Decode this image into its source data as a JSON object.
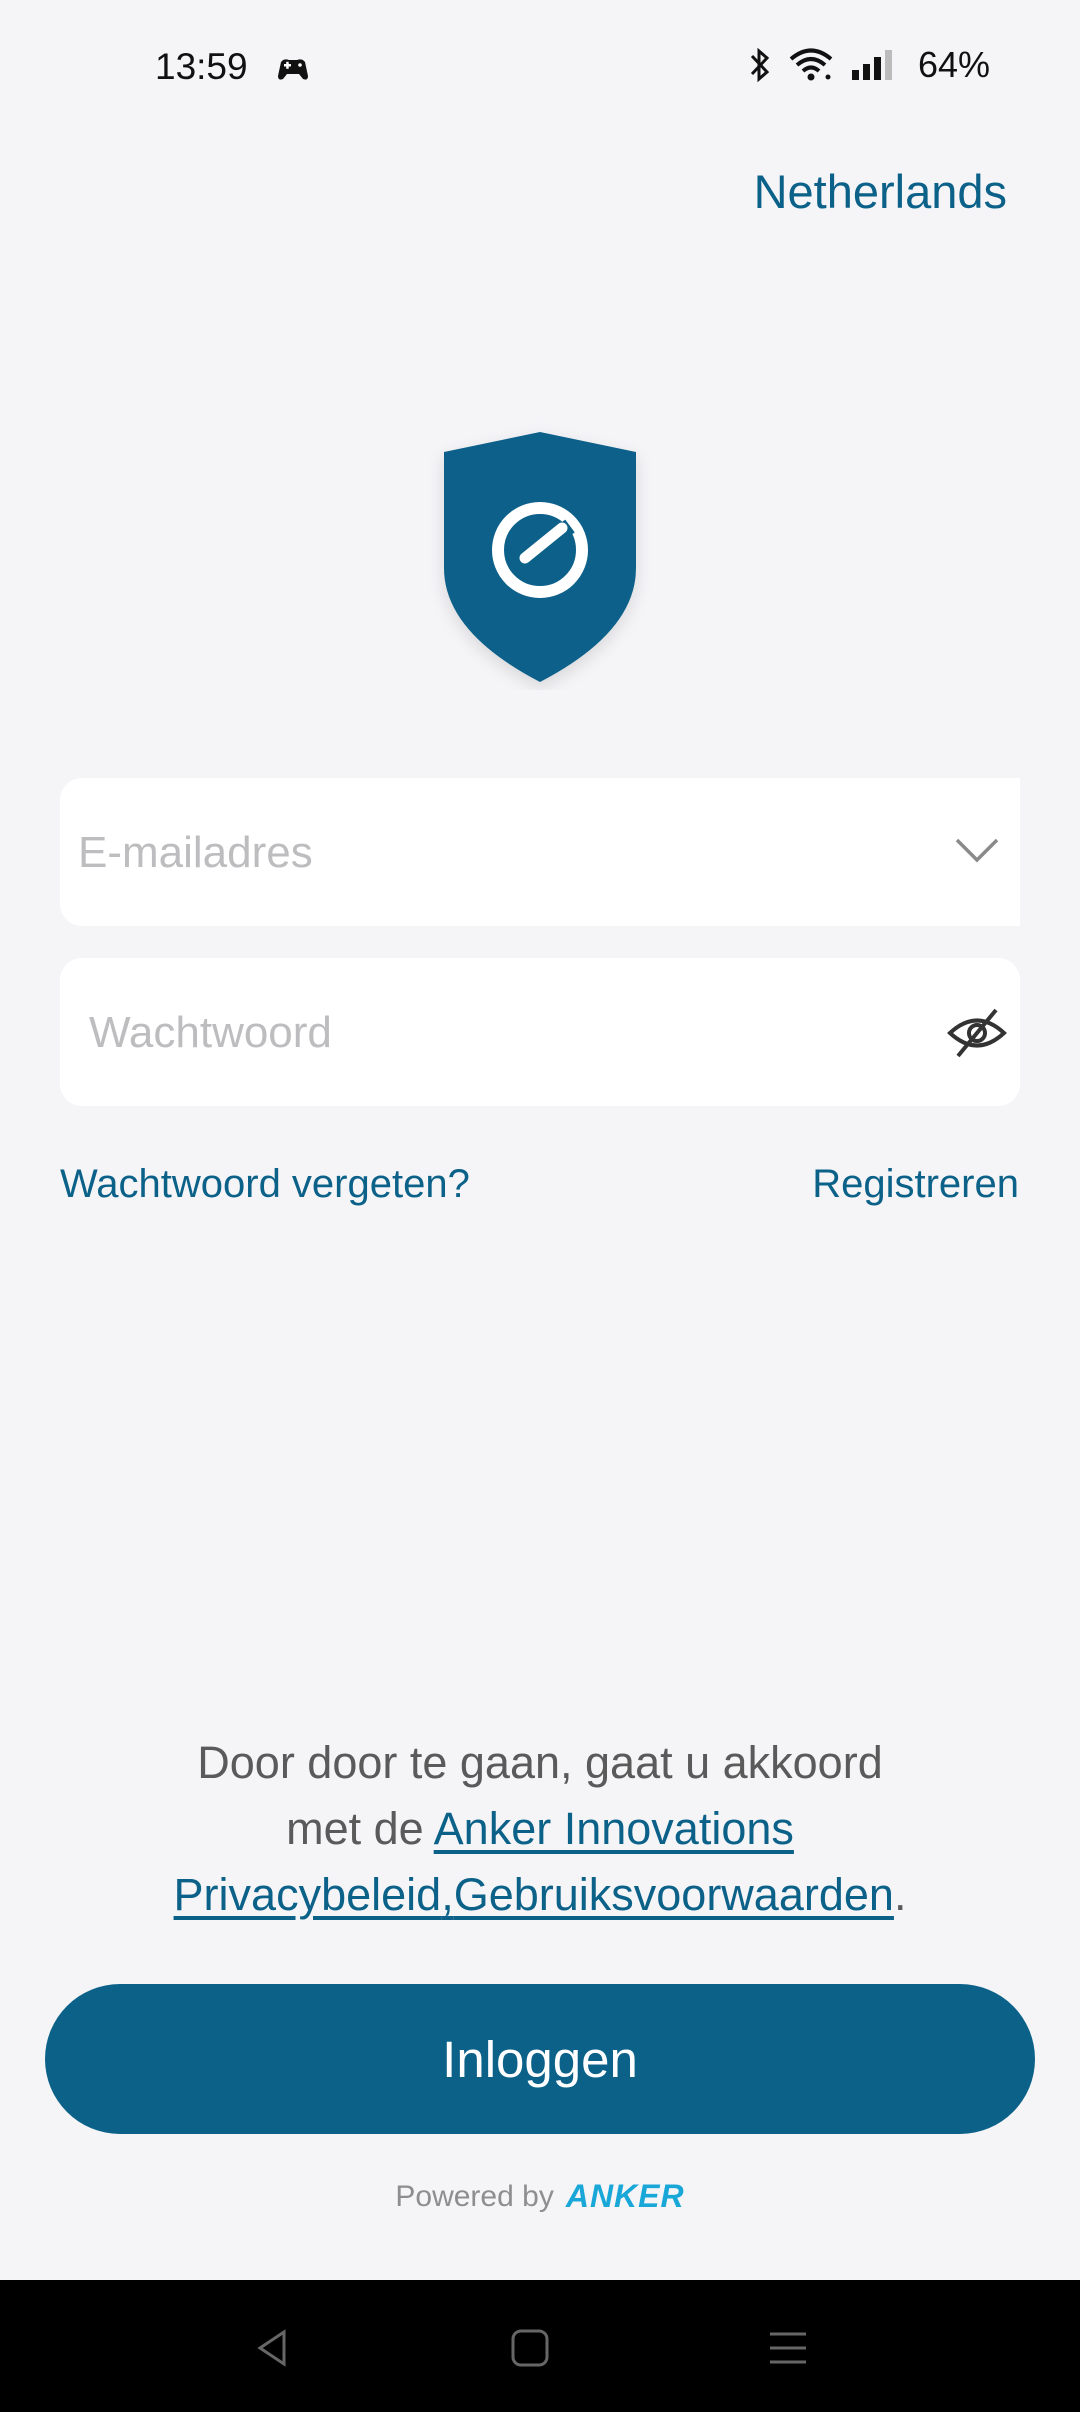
{
  "status_bar": {
    "time": "13:59",
    "battery": "64%",
    "icons": [
      "game-controller-icon",
      "bluetooth-icon",
      "wifi-icon",
      "cellular-signal-icon"
    ]
  },
  "header": {
    "region": "Netherlands"
  },
  "logo": {
    "icon": "eufy-shield-logo",
    "color": "#0c6189"
  },
  "form": {
    "email_placeholder": "E-mailadres",
    "email_value": "",
    "password_placeholder": "Wachtwoord",
    "password_value": "",
    "forgot_password": "Wachtwoord vergeten?",
    "register": "Registreren"
  },
  "terms": {
    "text_1": "Door door te gaan, gaat u akkoord",
    "text_2": "met de ",
    "link_1": "Anker Innovations",
    "link_2": "Privacybeleid",
    "separator": ",",
    "link_3": "Gebruiksvoorwaarden",
    "end": "."
  },
  "login_button": "Inloggen",
  "footer": {
    "powered_by": "Powered by",
    "brand": "ANKER"
  },
  "nav_bar": {
    "buttons": [
      "back-icon",
      "home-icon",
      "recents-icon"
    ]
  },
  "colors": {
    "accent": "#0c6189",
    "background": "#f5f5f8",
    "brand": "#19a7d8"
  }
}
